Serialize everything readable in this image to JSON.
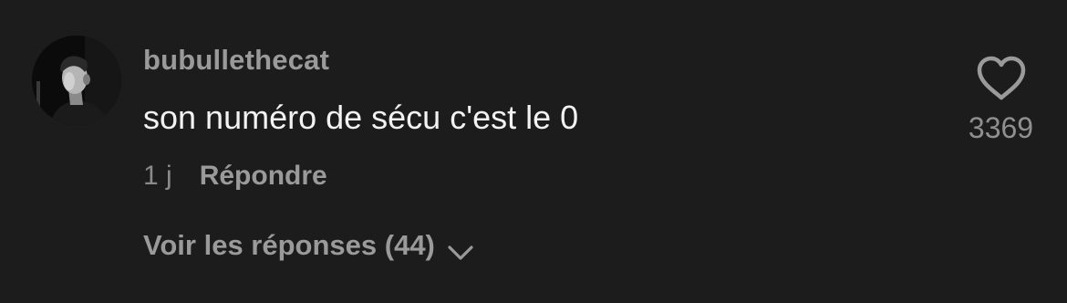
{
  "comment": {
    "username": "bubullethecat",
    "text": "son numéro de sécu c'est le 0",
    "time": "1 j",
    "reply_label": "Répondre",
    "view_replies_label": "Voir les réponses (44)",
    "like_count": "3369",
    "icons": {
      "like": "heart-icon",
      "expand": "chevron-down-icon"
    }
  }
}
